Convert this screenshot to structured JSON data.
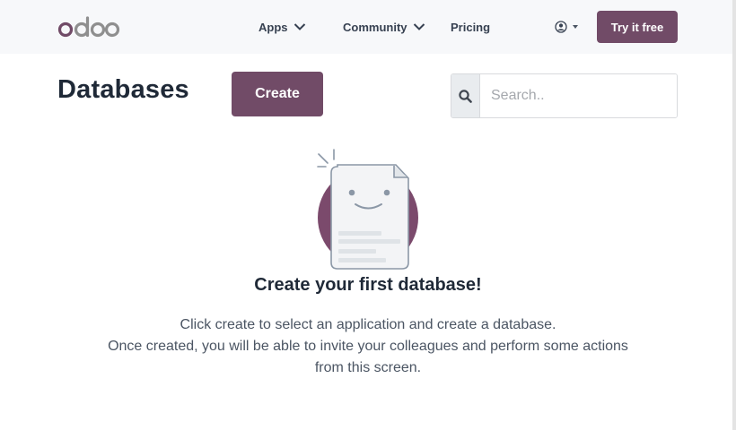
{
  "navbar": {
    "logo_text": "odoo",
    "menu": [
      {
        "label": "Apps",
        "icon": "chevron-down-icon"
      },
      {
        "label": "Community",
        "icon": "chevron-down-icon"
      },
      {
        "label": "Pricing"
      }
    ],
    "user_icon": "user-circle-icon",
    "cta_label": "Try it free"
  },
  "header": {
    "title": "Databases",
    "create_label": "Create",
    "search_placeholder": "Search.."
  },
  "empty_state": {
    "title": "Create your first database!",
    "line1": "Click create to select an application and create a database.",
    "line2": "Once created, you will be able to invite your colleagues and perform some actions",
    "line3": "from this screen."
  },
  "colors": {
    "brand": "#714b67",
    "navbar_bg": "#f7f8fa",
    "logo_gray": "#8f8f8f"
  }
}
